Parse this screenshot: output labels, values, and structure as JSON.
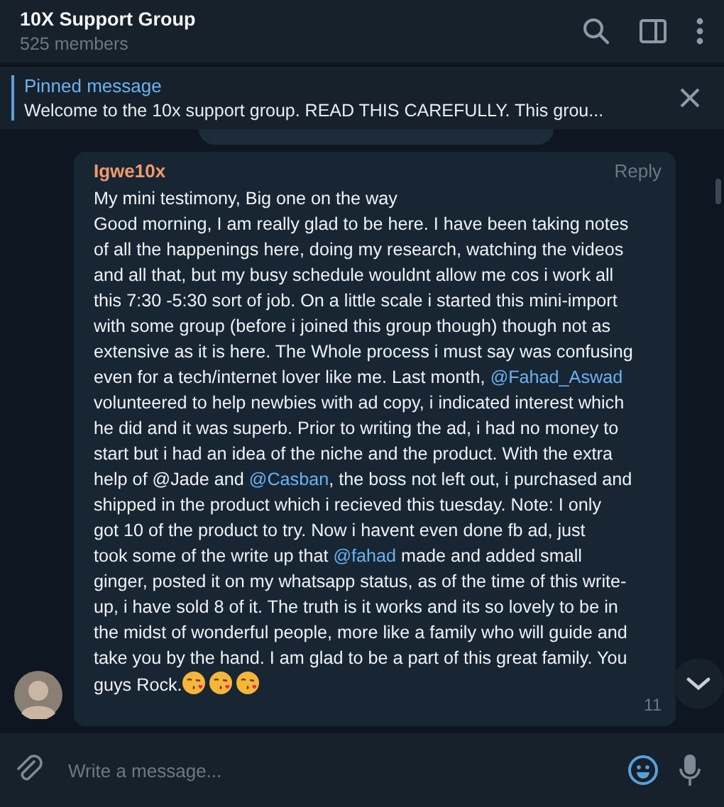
{
  "header": {
    "title": "10X Support Group",
    "subtitle": "525 members"
  },
  "pinned": {
    "label": "Pinned message",
    "text": "Welcome to the 10x support group.  READ THIS CAREFULLY.   This grou..."
  },
  "message": {
    "author": "Igwe10x",
    "reply": "Reply",
    "time": "11",
    "body": [
      {
        "kind": "text",
        "text": "My mini testimony, Big one on the way\nGood morning, I am really glad to be here. I have been taking notes\nof all the happenings here, doing my research, watching the videos\nand all that, but my busy schedule wouldnt allow me cos i work all\nthis 7:30 -5:30 sort of job. On a little scale i started this mini-import\nwith some group (before i joined this group though) though not as\nextensive as it is here. The Whole process i must say was confusing\neven for a tech/internet lover like me. Last month, "
      },
      {
        "kind": "mention",
        "text": "@Fahad_Aswad"
      },
      {
        "kind": "text",
        "text": "\nvolunteered to help newbies with ad copy, i indicated interest which\nhe did and it was superb. Prior to writing the ad, i had no money to\nstart but i had an idea of the niche and the product. With the extra\nhelp of @Jade and "
      },
      {
        "kind": "mention",
        "text": "@Casban"
      },
      {
        "kind": "text",
        "text": ", the boss not left out, i purchased and\nshipped in the product which i recieved this tuesday. Note: I only\ngot 10 of the product to try. Now i havent even done fb ad, just\ntook some of the write up that "
      },
      {
        "kind": "mention",
        "text": "@fahad"
      },
      {
        "kind": "text",
        "text": " made and added small\nginger, posted it on my whatsapp status, as of the time of this write-\nup, i have sold 8 of it. The truth is it works and its so lovely to be in\nthe midst of wonderful people, more like a family who will guide and\ntake you by the hand. I am glad to be a part of this great family. You\nguys Rock."
      }
    ]
  },
  "composer": {
    "placeholder": "Write a message..."
  }
}
